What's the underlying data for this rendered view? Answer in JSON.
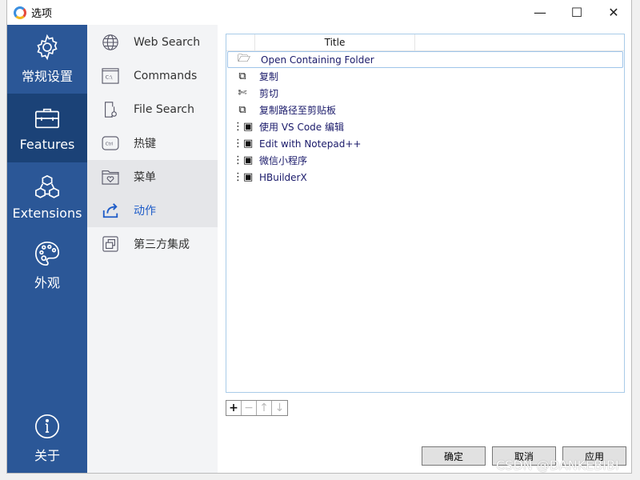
{
  "window": {
    "title": "选项",
    "controls": [
      "minimize",
      "maximize",
      "close"
    ]
  },
  "sidebar": {
    "items": [
      {
        "label": "常规设置",
        "icon": "gear-icon",
        "selected": false
      },
      {
        "label": "Features",
        "icon": "toolbox-icon",
        "selected": true
      },
      {
        "label": "Extensions",
        "icon": "cubes-icon",
        "selected": false
      },
      {
        "label": "外观",
        "icon": "palette-icon",
        "selected": false
      }
    ],
    "bottom": {
      "label": "关于",
      "icon": "info-icon"
    }
  },
  "subnav": {
    "items": [
      {
        "label": "Web Search",
        "icon": "globe-icon"
      },
      {
        "label": "Commands",
        "icon": "terminal-icon"
      },
      {
        "label": "File Search",
        "icon": "file-search-icon"
      },
      {
        "label": "热键",
        "icon": "ctrl-key-icon"
      },
      {
        "label": "菜单",
        "icon": "folder-heart-icon"
      },
      {
        "label": "动作",
        "icon": "share-icon",
        "selected": true
      },
      {
        "label": "第三方集成",
        "icon": "windows-icon"
      }
    ]
  },
  "table": {
    "columns": [
      "Title"
    ],
    "rows": [
      {
        "title": "Open Containing Folder",
        "icon": "folder-open-icon",
        "selected": true
      },
      {
        "title": "复制",
        "icon": "copy-icon"
      },
      {
        "title": "剪切",
        "icon": "scissors-icon"
      },
      {
        "title": "复制路径至剪贴板",
        "icon": "copy-icon"
      },
      {
        "title": "使用 VS Code 编辑",
        "icon": "window-list-icon"
      },
      {
        "title": "Edit with Notepad++",
        "icon": "window-list-icon"
      },
      {
        "title": "微信小程序",
        "icon": "window-list-icon"
      },
      {
        "title": "HBuilderX",
        "icon": "window-list-icon"
      }
    ]
  },
  "toolbar": {
    "add": "+",
    "remove": "−",
    "up": "↑",
    "down": "↓"
  },
  "buttons": {
    "ok": "确定",
    "cancel": "取消",
    "apply": "应用"
  },
  "watermark": "CSDN @DANKEBIBI",
  "colors": {
    "sidebar": "#2b5797",
    "sidebar_selected": "#1b4277",
    "accent": "#1e5cc8"
  }
}
